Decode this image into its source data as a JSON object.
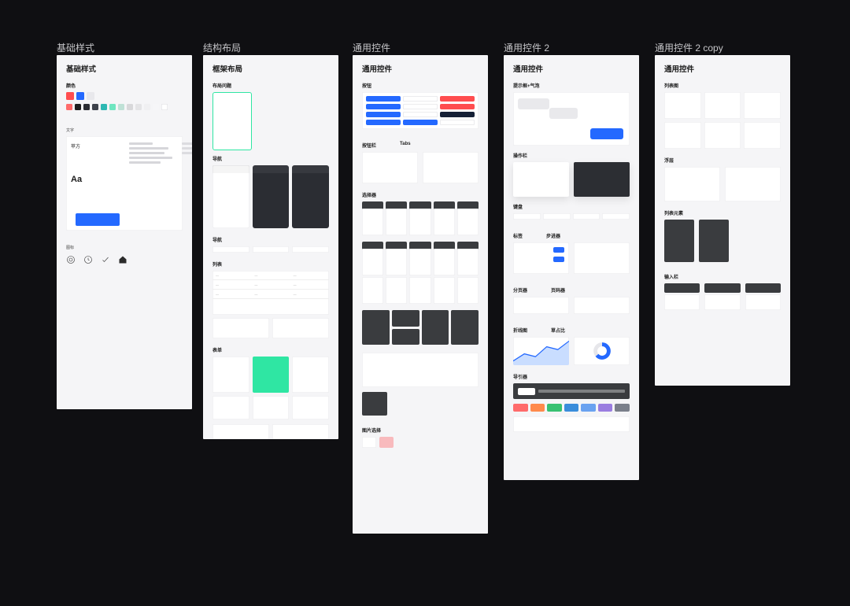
{
  "boards": {
    "b1": {
      "title": "基础样式",
      "heading": "基础样式",
      "sec_color": "颜色",
      "sec_text": "文字",
      "sec_icon": "图标",
      "typo_label1": "苹方",
      "typo_Aa": "Aa",
      "swatches_main": [
        "#ff4d4f",
        "#2469ff",
        "#e8e8ec"
      ],
      "swatches_row": [
        "#ff6b6b",
        "#1f1f1f",
        "#2b2d33",
        "#3e434c",
        "#2eb8b3",
        "#6ee6c0",
        "#bfe1d6",
        "#d8d8da",
        "#e4e4e6",
        "#f0f0f2",
        "#f6f6f8",
        "#ffffff"
      ]
    },
    "b2": {
      "title": "结构布局",
      "heading": "框架布局",
      "sec_frame": "布局问题",
      "sec_nav": "导航",
      "sec_tab": "导航",
      "sec_list": "列表",
      "sec_form": "表单"
    },
    "b3": {
      "title": "通用控件",
      "heading": "通用控件",
      "sec_button": "按钮",
      "sec_tab": "按钮栏",
      "tab_label": "Tabs",
      "sec_picker": "选择器",
      "sec_picker2": "选择器",
      "sec_img": "图片选择"
    },
    "b4": {
      "title": "通用控件 2",
      "heading": "通用控件",
      "sec_tip": "提示框+气泡",
      "sec_sheet": "操作栏",
      "sec_key": "键盘",
      "sec_badge": "标签",
      "sec_step": "步进器",
      "sec_page": "分页器",
      "sec_pagi": "页码器",
      "sec_chart": "折线图",
      "sec_pie": "草占比",
      "sec_dock": "导引器",
      "seg_colors": [
        "#ff6b6b",
        "#ff8a4c",
        "#38c172",
        "#3a8ddb",
        "#6aa2f0",
        "#9a7de0",
        "#7a7f8a"
      ]
    },
    "b5": {
      "title": "通用控件 2 copy",
      "heading": "通用控件",
      "sec_panel": "列表图",
      "sec_float": "浮层",
      "sec_list": "列表元素",
      "sec_input": "输入栏"
    }
  }
}
